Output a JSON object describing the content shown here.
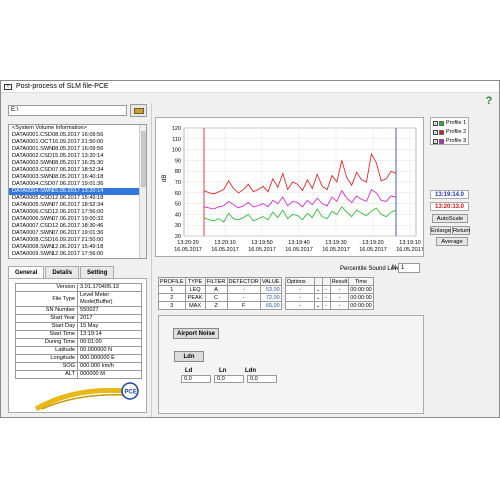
{
  "window": {
    "title": "Post-process of SLM file-PCE",
    "help_icon": "?"
  },
  "path": {
    "value": "E:\\"
  },
  "files": [
    {
      "name": "<System Volume Information>",
      "date": ""
    },
    {
      "name": "DATA0001.CSD",
      "date": "08.05.2017 16:09:56"
    },
    {
      "name": "DATA0001.OCT",
      "date": "16.09.2017 21:50:00"
    },
    {
      "name": "DATA0001.SWN",
      "date": "08.05.2017 16:09:56"
    },
    {
      "name": "DATA0002.CSD",
      "date": "15.05.2017 13:20:14"
    },
    {
      "name": "DATA0002.SWN",
      "date": "08.05.2017 16:25:30"
    },
    {
      "name": "DATA0003.CSD",
      "date": "07.06.2017 18:52:34"
    },
    {
      "name": "DATA0003.SWN",
      "date": "08.05.2017 16:40:18"
    },
    {
      "name": "DATA0004.CSD",
      "date": "07.06.2017 19:01:36"
    },
    {
      "name": "DATA0004.SWN",
      "date": "15.05.2017 13:20:14"
    },
    {
      "name": "DATA0005.CSD",
      "date": "12.06.2017 15:49:18"
    },
    {
      "name": "DATA0005.SWN",
      "date": "07.06.2017 18:52:34"
    },
    {
      "name": "DATA0006.CSD",
      "date": "12.06.2017 17:56:00"
    },
    {
      "name": "DATA0006.SWN",
      "date": "07.06.2017 19:00:32"
    },
    {
      "name": "DATA0007.CSD",
      "date": "12.06.2017 18:30:46"
    },
    {
      "name": "DATA0007.SWN",
      "date": "07.06.2017 19:01:36"
    },
    {
      "name": "DATA0008.CSD",
      "date": "16.09.2017 21:50:00"
    },
    {
      "name": "DATA0008.SWN",
      "date": "12.06.2017 15:49:18"
    },
    {
      "name": "DATA0009.SWN",
      "date": "12.06.2017 17:56:00"
    }
  ],
  "tabs": [
    "General",
    "Details",
    "Setting"
  ],
  "info": [
    {
      "k": "Version",
      "v": "3.01.170405.13"
    },
    {
      "k": "File Type",
      "v": "Level Meter Mode(Buffer)"
    },
    {
      "k": "SN Number",
      "v": "550027"
    },
    {
      "k": "Start Year",
      "v": "2017"
    },
    {
      "k": "Start Day",
      "v": "15 May"
    },
    {
      "k": "Start Time",
      "v": "13:19:14"
    },
    {
      "k": "During Time",
      "v": "00:01:00"
    },
    {
      "k": "Latitude",
      "v": "00.000000 N"
    },
    {
      "k": "Longitude",
      "v": "000.000000 E"
    },
    {
      "k": "SOG",
      "v": "000.000 km/h"
    },
    {
      "k": "ALT",
      "v": "000000 M"
    }
  ],
  "chart_data": {
    "type": "line",
    "ylabel": "dB",
    "ylim": [
      20,
      120
    ],
    "yticks": [
      "20",
      "30",
      "40",
      "50",
      "60",
      "70",
      "80",
      "90",
      "100",
      "110",
      "120"
    ],
    "xticks": [
      {
        "time": "13:20:20",
        "date": "16.05.2017"
      },
      {
        "time": "13:20:10",
        "date": "16.05.2017"
      },
      {
        "time": "13:19:50",
        "date": "16.05.2017"
      },
      {
        "time": "13:19:40",
        "date": "16.05.2017"
      },
      {
        "time": "13:19:30",
        "date": "16.05.2017"
      },
      {
        "time": "13:19:20",
        "date": "16.05.2017"
      },
      {
        "time": "13:19:10",
        "date": "16.05.2017"
      }
    ],
    "series": [
      {
        "name": "Profile 1",
        "color": "#22bb22",
        "values": [
          37,
          35,
          34,
          36,
          33,
          41,
          36,
          35,
          37,
          40,
          34,
          36,
          38,
          35,
          42,
          37,
          44,
          36,
          40,
          39,
          35,
          41,
          37,
          45,
          38,
          36,
          43,
          40,
          47,
          42,
          38,
          44,
          41,
          39,
          43,
          46,
          40,
          38,
          42,
          44
        ]
      },
      {
        "name": "Profile 2",
        "color": "#ee1111",
        "values": [
          62,
          60,
          59,
          61,
          63,
          71,
          64,
          60,
          63,
          68,
          61,
          63,
          66,
          61,
          73,
          65,
          78,
          63,
          70,
          68,
          62,
          72,
          64,
          77,
          66,
          63,
          76,
          70,
          90,
          74,
          67,
          79,
          72,
          70,
          96,
          88,
          71,
          73,
          80,
          78
        ]
      },
      {
        "name": "Profile 3",
        "color": "#dd11dd",
        "values": [
          47,
          46,
          45,
          47,
          48,
          52,
          49,
          46,
          48,
          51,
          47,
          48,
          50,
          47,
          53,
          50,
          56,
          48,
          52,
          51,
          47,
          53,
          49,
          55,
          50,
          48,
          56,
          52,
          62,
          55,
          51,
          57,
          54,
          52,
          63,
          60,
          53,
          52,
          57,
          56
        ]
      }
    ]
  },
  "profiles": [
    {
      "label": "Profile 1",
      "color": "#22bb22",
      "checked": "✓"
    },
    {
      "label": "Profile 2",
      "color": "#ee1111",
      "checked": "✓"
    },
    {
      "label": "Profile 3",
      "color": "#dd11dd",
      "checked": "✓"
    }
  ],
  "cursor1": {
    "time": "13:19:14.0",
    "color": "#1a33bb"
  },
  "cursor2": {
    "time": "13:20:13.0",
    "color": "#dd1111"
  },
  "buttons": {
    "autoscale": "AutoScale",
    "enlarge": "Enlarge",
    "return": "Return",
    "average": "Average"
  },
  "percentile": {
    "label": "Percentile Sound Level",
    "n_label": "N",
    "value": "1"
  },
  "profile_table": {
    "headers": [
      "PROFILE",
      "TYPE",
      "FILTER",
      "DETECTOR",
      "VALUE"
    ],
    "rows": [
      [
        "1",
        "LEQ",
        "A",
        "-",
        "53,00"
      ],
      [
        "2",
        "PEAK",
        "C",
        "-",
        "72,00"
      ],
      [
        "3",
        "MAX",
        "Z",
        "F",
        "65,00"
      ]
    ]
  },
  "options_table": {
    "headers": [
      "Options",
      "",
      "",
      "Result",
      "Time"
    ],
    "rows": [
      [
        "-",
        "-",
        "-",
        "00:00:00"
      ],
      [
        "-",
        "-",
        "-",
        "00:00:00"
      ],
      [
        "-",
        "-",
        "-",
        "00:00:00"
      ]
    ]
  },
  "bottom": {
    "airport_noise": "Airport Noise",
    "ldn_button": "Ldn",
    "ld_label": "Ld",
    "ln_label": "Ln",
    "ldn_label": "Ldn",
    "ld_value": "0,0",
    "ln_value": "0,0",
    "ldn_value": "0,0"
  }
}
